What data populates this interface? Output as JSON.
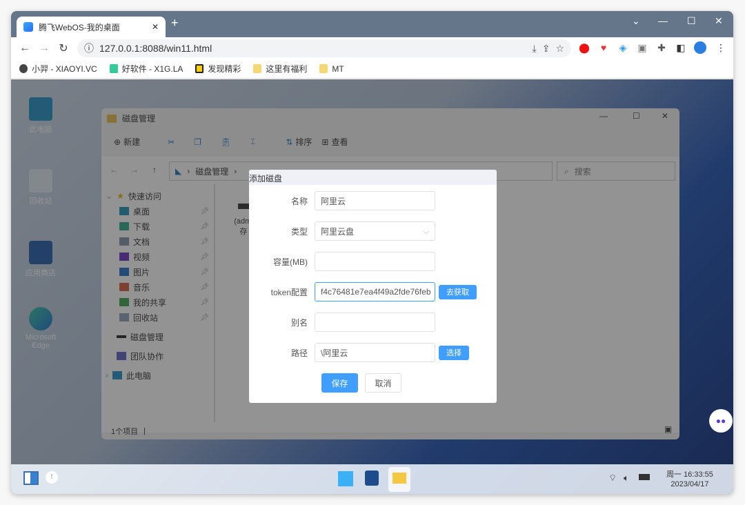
{
  "browser": {
    "tab_title": "腾飞WebOS-我的桌面",
    "url": "127.0.0.1:8088/win11.html",
    "bookmarks": [
      "小羿 - XIAOYI.VC",
      "好软件 - X1G.LA",
      "发现精彩",
      "这里有福利",
      "MT"
    ]
  },
  "desktop": {
    "icons": [
      "此电脑",
      "回收站",
      "应用商店",
      "Microsoft Edge"
    ]
  },
  "explorer": {
    "title": "磁盘管理",
    "toolbar": {
      "new": "新建",
      "sort": "排序",
      "view": "查看"
    },
    "breadcrumb": "磁盘管理",
    "search_placeholder": "搜索",
    "quick_access": "快速访问",
    "quick_items": [
      "桌面",
      "下载",
      "文档",
      "视频",
      "图片",
      "音乐",
      "我的共享",
      "回收站"
    ],
    "other_items": [
      "磁盘管理",
      "团队协作",
      "此电脑"
    ],
    "file_label": "(admi",
    "file_label2": "存",
    "status": "1个项目"
  },
  "dialog": {
    "title": "添加磁盘",
    "fields": {
      "name_label": "名称",
      "name_value": "阿里云",
      "type_label": "类型",
      "type_value": "阿里云盘",
      "capacity_label": "容量(MB)",
      "capacity_value": "",
      "token_label": "token配置",
      "token_value": "f4c76481e7ea4f49a2fde76feb",
      "alias_label": "别名",
      "alias_value": "",
      "path_label": "路径",
      "path_value": "\\阿里云"
    },
    "get_token": "去获取",
    "choose": "选择",
    "save": "保存",
    "cancel": "取消",
    "accent": "#409eff"
  },
  "taskbar": {
    "time": "周一 16:33:55",
    "date": "2023/04/17"
  }
}
